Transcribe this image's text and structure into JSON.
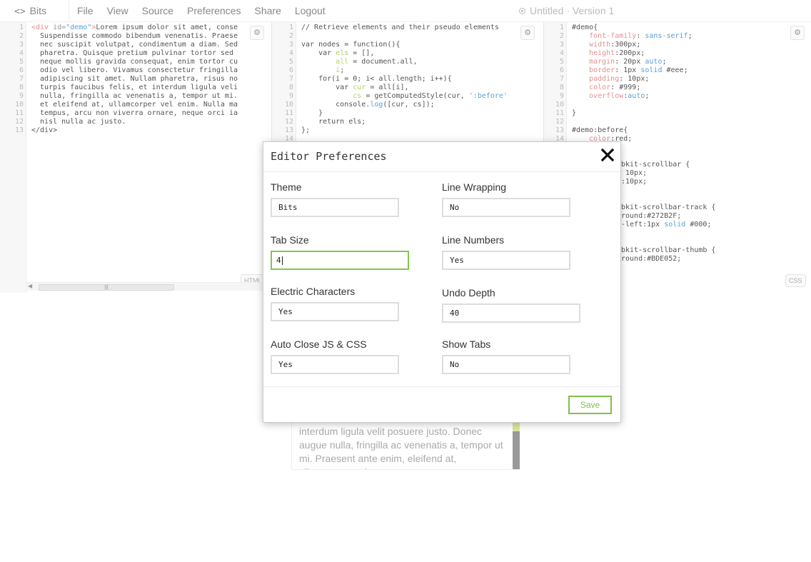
{
  "topbar": {
    "brand_icon": "<>",
    "brand": "Bits",
    "menu": [
      "File",
      "View",
      "Source",
      "Preferences",
      "Share",
      "Logout"
    ],
    "title": "Untitled",
    "separator": "·",
    "version": "Version 1"
  },
  "html_pane": {
    "label": "HTML",
    "line_numbers": [
      "1",
      "2",
      "3",
      "4",
      "5",
      "6",
      "7",
      "8",
      "9",
      "10",
      "11",
      "12",
      "13"
    ],
    "lines": [
      {
        "tag_open": "<div",
        "attr": " id=",
        "str": "\"demo\"",
        "tag_close": ">",
        "text": "Lorem ipsum dolor sit amet, conse"
      },
      {
        "text": "  Suspendisse commodo bibendum venenatis. Praese"
      },
      {
        "text": "  nec suscipit volutpat, condimentum a diam. Sed"
      },
      {
        "text": "  pharetra. Quisque pretium pulvinar tortor sed"
      },
      {
        "text": "  neque mollis gravida consequat, enim tortor cu"
      },
      {
        "text": "  odio vel libero. Vivamus consectetur fringilla"
      },
      {
        "text": "  adipiscing sit amet. Nullam pharetra, risus no"
      },
      {
        "text": "  turpis faucibus felis, et interdum ligula veli"
      },
      {
        "text": "  nulla, fringilla ac venenatis a, tempor ut mi."
      },
      {
        "text": "  et eleifend at, ullamcorper vel enim. Nulla ma"
      },
      {
        "text": "  tempus, arcu non viverra ornare, neque orci ia"
      },
      {
        "text": "  nisl nulla ac justo."
      },
      {
        "closing": "</div>"
      }
    ]
  },
  "js_pane": {
    "line_numbers": [
      "1",
      "2",
      "3",
      "4",
      "5",
      "6",
      "7",
      "8",
      "9",
      "10",
      "11",
      "12",
      "13",
      "14"
    ],
    "comment": "// Retrieve elements and their pseudo elements",
    "l3": "var nodes = function(){",
    "l4a": "    var ",
    "l4b": "els",
    "l4c": " = [],",
    "l5a": "        ",
    "l5b": "all",
    "l5c": " = document.all,",
    "l6a": "        ",
    "l6b": "i",
    "l6c": ";",
    "l7": "    for(i = 0; i< all.length; i++){",
    "l8a": "        var ",
    "l8b": "cur",
    "l8c": " = all[i],",
    "l9a": "            ",
    "l9b": "cs",
    "l9c": " = getComputedStyle(cur, ",
    "l9d": "':before'",
    "l10a": "        console.",
    "l10b": "log",
    "l10c": "([cur, cs]);",
    "l11": "    }",
    "l12": "    return els;",
    "l13": "};"
  },
  "css_pane": {
    "label": "CSS",
    "line_numbers": [
      "1",
      "2",
      "3",
      "4",
      "5",
      "6",
      "7",
      "8",
      "9",
      "10",
      "11",
      "12",
      "13",
      "14"
    ],
    "l1": "#demo{",
    "l2p": "    font-family",
    "l2v": " sans-serif",
    "l3p": "    width",
    "l3v": "300px",
    "l4p": "    height",
    "l4v": "200px",
    "l5p": "    margin",
    "l5v1": " 20px ",
    "l5v2": "auto",
    "l6p": "    border",
    "l6v1": " 1px ",
    "l6v2": "solid",
    "l6v3": " #eee",
    "l7p": "    padding",
    "l7v": " 10px",
    "l8p": "    color",
    "l8v": " #999",
    "l9p": "    overflow",
    "l9v": "auto",
    "l11": "}",
    "l13": "#demo:before{",
    "l14p": "    color",
    "l14v": "red",
    "frag1": "bkit-scrollbar {",
    "frag2": " 10px;",
    "frag3": ":10px;",
    "frag4": "bkit-scrollbar-track {",
    "frag5": "round:#272B2F;",
    "frag6": "-left:1px ",
    "frag6b": "solid",
    "frag6c": " #000;",
    "frag7": "bkit-scrollbar-thumb {",
    "frag8": "round:#BDE052;"
  },
  "preview": {
    "text": "interdum ligula velit posuere justo. Donec augue nulla, fringilla ac venenatis a, tempor ut mi. Praesent ante enim, eleifend at, ullamcorper vel"
  },
  "modal": {
    "title": "Editor Preferences",
    "fields": [
      {
        "label": "Theme",
        "value": "Bits"
      },
      {
        "label": "Line Wrapping",
        "value": "No"
      },
      {
        "label": "Tab Size",
        "value": "4"
      },
      {
        "label": "Line Numbers",
        "value": "Yes"
      },
      {
        "label": "Electric Characters",
        "value": "Yes"
      },
      {
        "label": "Undo Depth",
        "value": "40"
      },
      {
        "label": "Auto Close JS & CSS",
        "value": "Yes"
      },
      {
        "label": "Show Tabs",
        "value": "No"
      }
    ],
    "save_label": "Save"
  },
  "icons": [
    "code-icon",
    "record-icon",
    "gear-icon",
    "close-icon",
    "scroll-left-icon"
  ],
  "colors": {
    "accent_green": "#7fc04a",
    "active_border": "#86c44f"
  }
}
